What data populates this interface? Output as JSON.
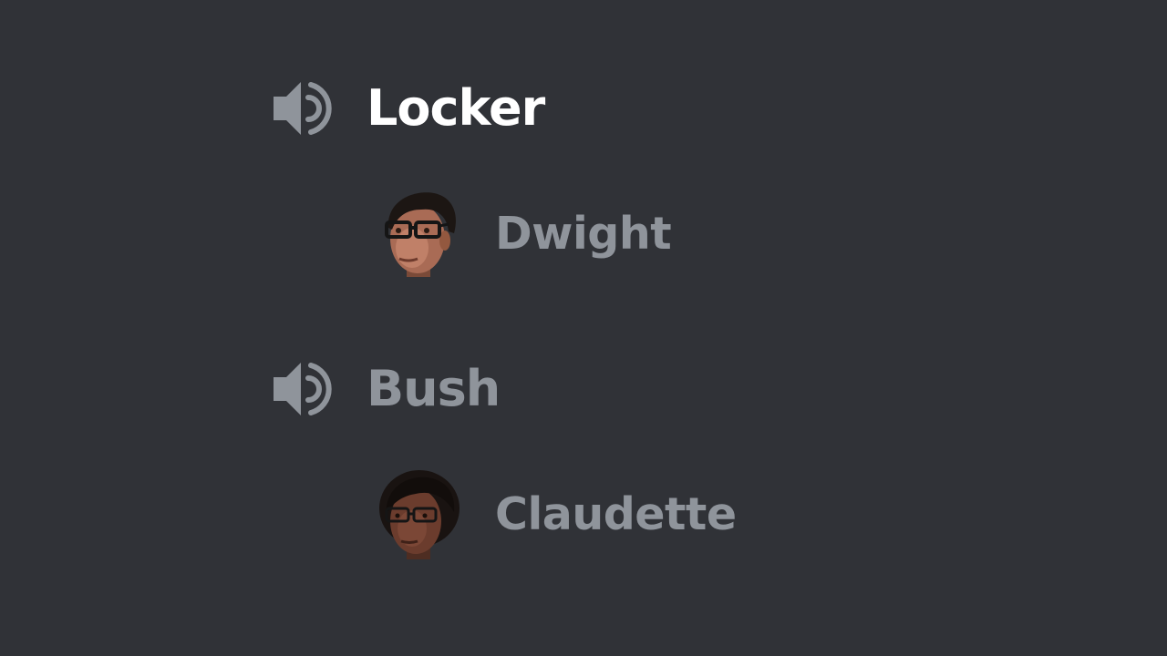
{
  "voice_channels": [
    {
      "name": "Locker",
      "icon": "speaker-icon",
      "state": "active",
      "members": [
        {
          "name": "Dwight",
          "avatar": "dwight-avatar"
        }
      ]
    },
    {
      "name": "Bush",
      "icon": "speaker-icon",
      "state": "inactive",
      "members": [
        {
          "name": "Claudette",
          "avatar": "claudette-avatar"
        }
      ]
    }
  ],
  "colors": {
    "background": "#303237",
    "active_text": "#ffffff",
    "muted_text": "#8f949b",
    "icon": "#8f949b"
  }
}
